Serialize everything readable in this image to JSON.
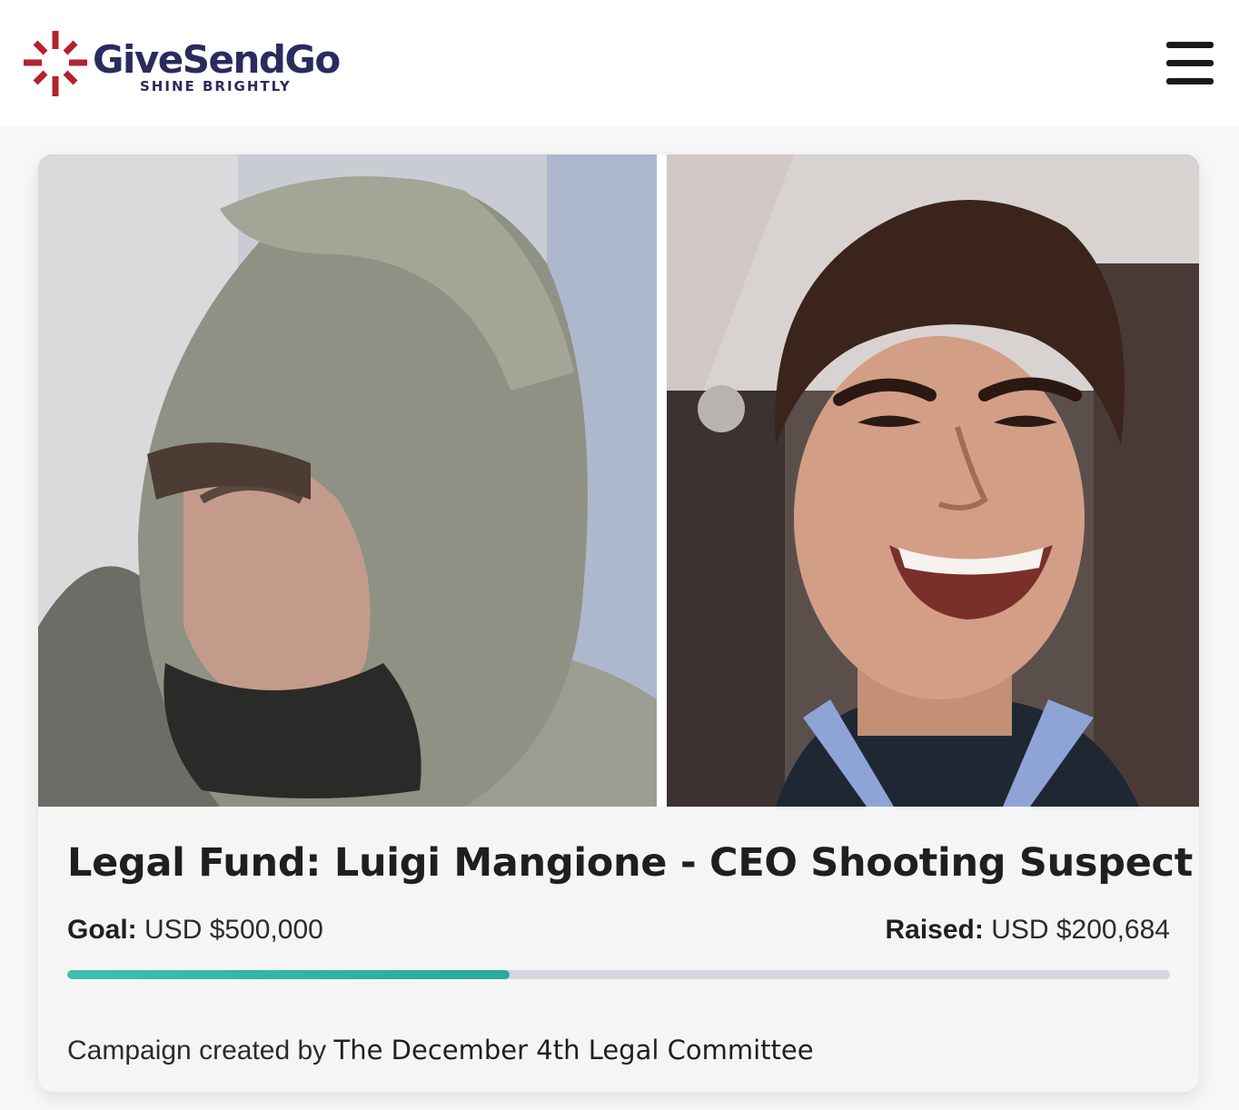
{
  "brand": {
    "name": "GiveSendGo",
    "tagline": "SHINE BRIGHTLY",
    "accent_color": "#b3222e",
    "text_color": "#2a2b5e"
  },
  "header": {
    "menu_icon": "hamburger-menu-icon"
  },
  "campaign": {
    "title": "Legal Fund: Luigi Mangione - CEO Shooting Suspect",
    "goal_label": "Goal:",
    "goal_value": "USD $500,000",
    "raised_label": "Raised:",
    "raised_value": "USD $200,684",
    "progress_fraction": 0.4014,
    "created_by_label": "Campaign created by",
    "created_by_name": "The December 4th Legal Committee",
    "progress_color": "#35b5a7"
  }
}
